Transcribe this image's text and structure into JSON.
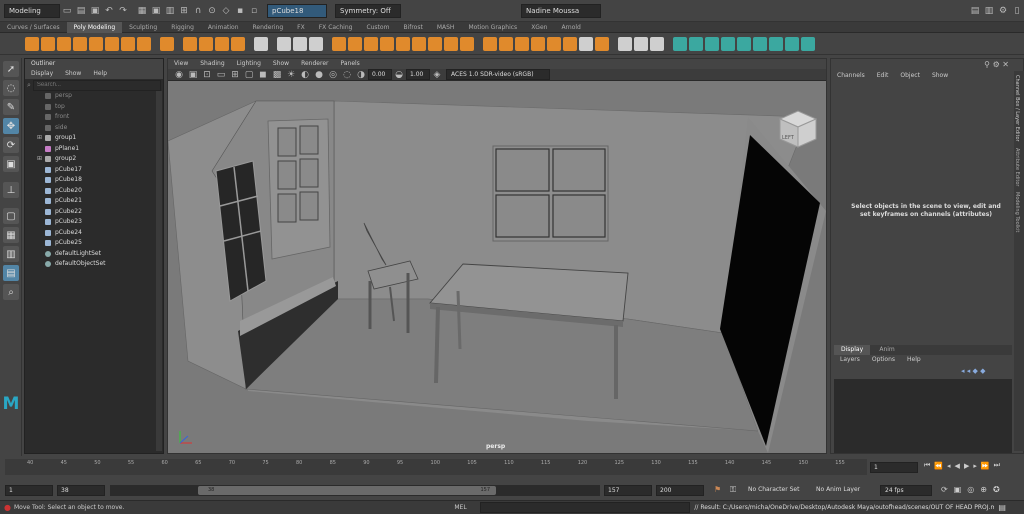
{
  "topbar": {
    "mode": "Modeling",
    "object_field": "pCube18",
    "symmetry": "Symmetry: Off",
    "user": "Nadine Moussa"
  },
  "shelf_tabs": [
    "Curves / Surfaces",
    "Poly Modeling",
    "Sculpting",
    "Rigging",
    "Animation",
    "Rendering",
    "FX",
    "FX Caching",
    "Custom",
    "Bifrost",
    "MASH",
    "Motion Graphics",
    "XGen",
    "Arnold"
  ],
  "shelf_active": "Poly Modeling",
  "outliner": {
    "title": "Outliner",
    "menu": [
      "Display",
      "Show",
      "Help"
    ],
    "search_placeholder": "Search...",
    "items": [
      {
        "label": "persp",
        "dim": true
      },
      {
        "label": "top",
        "dim": true
      },
      {
        "label": "front",
        "dim": true
      },
      {
        "label": "side",
        "dim": true
      },
      {
        "label": "group1"
      },
      {
        "label": "pPlane1"
      },
      {
        "label": "group2"
      },
      {
        "label": "pCube17"
      },
      {
        "label": "pCube18"
      },
      {
        "label": "pCube20"
      },
      {
        "label": "pCube21"
      },
      {
        "label": "pCube22"
      },
      {
        "label": "pCube23"
      },
      {
        "label": "pCube24"
      },
      {
        "label": "pCube25"
      },
      {
        "label": "defaultLightSet"
      },
      {
        "label": "defaultObjectSet"
      }
    ]
  },
  "viewport": {
    "menu": [
      "View",
      "Shading",
      "Lighting",
      "Show",
      "Renderer",
      "Panels"
    ],
    "gamma": "0.00",
    "exposure": "1.00",
    "color_space": "ACES 1.0 SDR-video (sRGB)",
    "camera_label": "persp",
    "view_cube": "LEFT"
  },
  "channel_box": {
    "menu": [
      "Channels",
      "Edit",
      "Object",
      "Show"
    ],
    "message": "Select objects in the scene to view, edit and set keyframes on channels (attributes)",
    "layer_tabs": [
      "Display",
      "Anim"
    ],
    "layer_menu": [
      "Layers",
      "Options",
      "Help"
    ],
    "side_tabs": [
      "Channel Box / Layer Editor",
      "Attribute Editor",
      "Modeling Toolkit"
    ]
  },
  "timeline": {
    "ticks": [
      "40",
      "45",
      "50",
      "55",
      "60",
      "65",
      "70",
      "75",
      "80",
      "85",
      "90",
      "95",
      "100",
      "105",
      "110",
      "115",
      "120",
      "125",
      "130",
      "135",
      "140",
      "145",
      "150",
      "155"
    ],
    "current_frame": "1"
  },
  "range": {
    "start": "1",
    "anim_start": "38",
    "slider_start": "38",
    "slider_end": "157",
    "anim_end": "157",
    "end": "200",
    "character": "No Character Set",
    "anim_layer": "No Anim Layer",
    "fps": "24 fps"
  },
  "cmdline": {
    "lang": "MEL",
    "result": "// Result: C:/Users/micha/OneDrive/Desktop/Autodesk Maya/outofhead/scenes/OUT OF HEAD PROJ.mb"
  },
  "status": {
    "help": "Move Tool: Select an object to move."
  }
}
